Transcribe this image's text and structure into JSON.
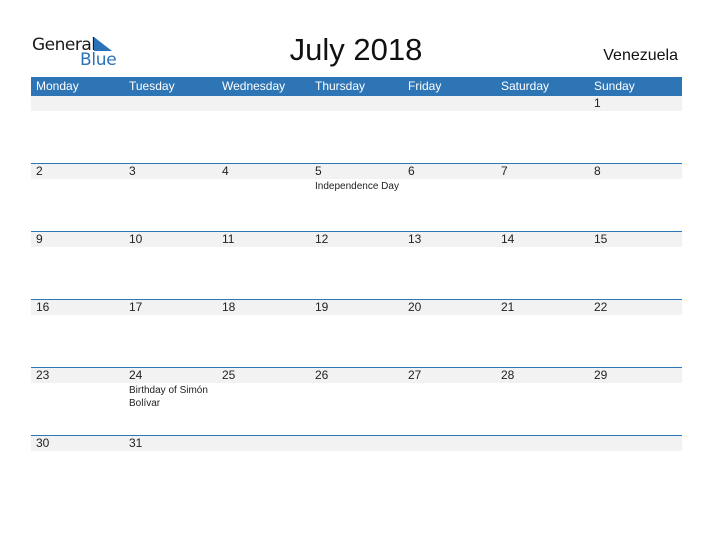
{
  "logo": {
    "line1": "General",
    "line2": "Blue"
  },
  "title": "July 2018",
  "country": "Venezuela",
  "weekdays": [
    "Monday",
    "Tuesday",
    "Wednesday",
    "Thursday",
    "Friday",
    "Saturday",
    "Sunday"
  ],
  "weeks": [
    [
      {
        "d": ""
      },
      {
        "d": ""
      },
      {
        "d": ""
      },
      {
        "d": ""
      },
      {
        "d": ""
      },
      {
        "d": ""
      },
      {
        "d": "1"
      }
    ],
    [
      {
        "d": "2"
      },
      {
        "d": "3"
      },
      {
        "d": "4"
      },
      {
        "d": "5",
        "e": "Independence Day"
      },
      {
        "d": "6"
      },
      {
        "d": "7"
      },
      {
        "d": "8"
      }
    ],
    [
      {
        "d": "9"
      },
      {
        "d": "10"
      },
      {
        "d": "11"
      },
      {
        "d": "12"
      },
      {
        "d": "13"
      },
      {
        "d": "14"
      },
      {
        "d": "15"
      }
    ],
    [
      {
        "d": "16"
      },
      {
        "d": "17"
      },
      {
        "d": "18"
      },
      {
        "d": "19"
      },
      {
        "d": "20"
      },
      {
        "d": "21"
      },
      {
        "d": "22"
      }
    ],
    [
      {
        "d": "23"
      },
      {
        "d": "24",
        "e": "Birthday of Simón Bolívar"
      },
      {
        "d": "25"
      },
      {
        "d": "26"
      },
      {
        "d": "27"
      },
      {
        "d": "28"
      },
      {
        "d": "29"
      }
    ],
    [
      {
        "d": "30"
      },
      {
        "d": "31"
      },
      {
        "d": ""
      },
      {
        "d": ""
      },
      {
        "d": ""
      },
      {
        "d": ""
      },
      {
        "d": ""
      }
    ]
  ],
  "colors": {
    "accent": "#2e75b6",
    "band": "#f2f2f2"
  }
}
